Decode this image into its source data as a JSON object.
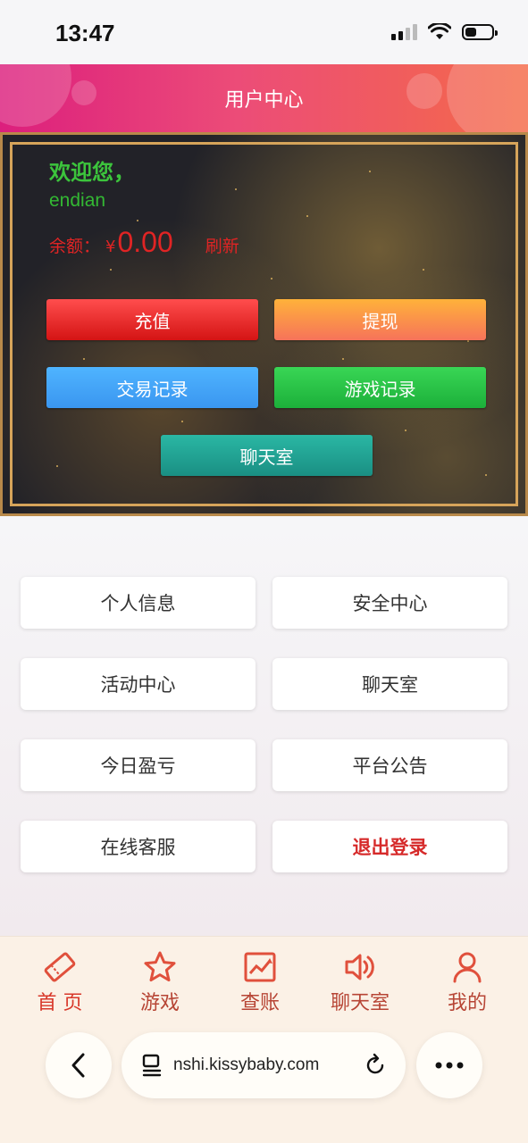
{
  "status_bar": {
    "time": "13:47"
  },
  "header": {
    "title": "用户中心"
  },
  "account": {
    "welcome": "欢迎您，",
    "username": "endian",
    "balance_label": "余额：",
    "currency": "¥",
    "balance": "0.00",
    "refresh": "刷新"
  },
  "actions": {
    "recharge": "充值",
    "withdraw": "提现",
    "transactions": "交易记录",
    "game_records": "游戏记录",
    "chat_room": "聊天室"
  },
  "menu": {
    "personal_info": "个人信息",
    "security_center": "安全中心",
    "activity_center": "活动中心",
    "chat_room": "聊天室",
    "today_pnl": "今日盈亏",
    "announcements": "平台公告",
    "customer_service": "在线客服",
    "logout": "退出登录"
  },
  "tabs": [
    {
      "label": "首 页",
      "icon": "ticket-icon"
    },
    {
      "label": "游戏",
      "icon": "star-icon"
    },
    {
      "label": "查账",
      "icon": "chart-icon"
    },
    {
      "label": "聊天室",
      "icon": "speaker-icon"
    },
    {
      "label": "我的",
      "icon": "user-icon"
    }
  ],
  "browser": {
    "url": "nshi.kissybaby.com"
  },
  "colors": {
    "header_start": "#dc1f7d",
    "header_end": "#f46a48",
    "accent_red": "#d8382a",
    "welcome_green": "#3cc43c"
  }
}
